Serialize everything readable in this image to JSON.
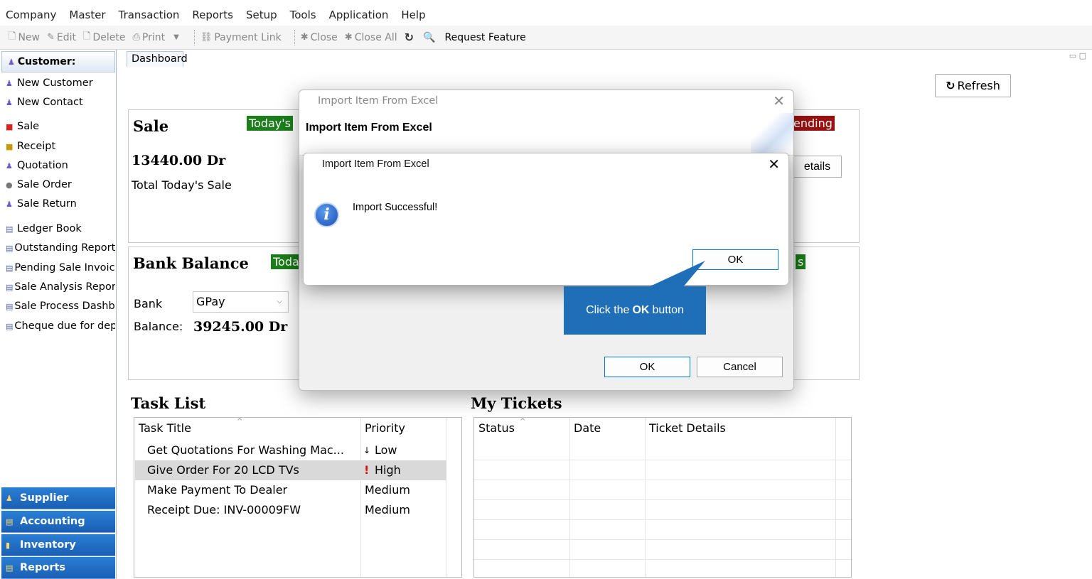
{
  "menu": [
    "Company",
    "Master",
    "Transaction",
    "Reports",
    "Setup",
    "Tools",
    "Application",
    "Help"
  ],
  "toolbar": {
    "new": "New",
    "edit": "Edit",
    "delete": "Delete",
    "print": "Print",
    "payment_link": "Payment Link",
    "close": "Close",
    "close_all": "Close All",
    "request_feature": "Request Feature"
  },
  "sidebar": {
    "header": "Customer:",
    "items": [
      "New Customer",
      "New Contact",
      "Sale",
      "Receipt",
      "Quotation",
      "Sale Order",
      "Sale Return",
      "Ledger Book",
      "Outstanding Report",
      "Pending Sale Invoices",
      "Sale Analysis Report",
      "Sale Process Dashboa",
      "Cheque due for depos"
    ],
    "groups": [
      "Supplier",
      "Accounting",
      "Inventory",
      "Reports"
    ]
  },
  "tab": {
    "label": "Dashboard"
  },
  "refresh_label": "Refresh",
  "sale_panel": {
    "title": "Sale",
    "tag": "Today's",
    "value": "13440.00 Dr",
    "caption": "Total Today's Sale",
    "right_tag": "ending",
    "right_button": "etails"
  },
  "bank_panel": {
    "title": "Bank Balance",
    "tag": "Toda",
    "bank_label": "Bank",
    "bank_value": "GPay",
    "balance_label": "Balance:",
    "balance_value": "39245.00 Dr",
    "right_tag": "s"
  },
  "task_list": {
    "title": "Task List",
    "columns": [
      "Task Title",
      "Priority"
    ],
    "rows": [
      {
        "title": "Get Quotations For Washing Mac...",
        "priority_icon": "↓",
        "priority": "Low"
      },
      {
        "title": "Give Order For 20 LCD TVs",
        "priority_icon": "!",
        "priority": "High"
      },
      {
        "title": "Make Payment To Dealer",
        "priority_icon": "",
        "priority": "Medium"
      },
      {
        "title": "Receipt Due: INV-00009FW",
        "priority_icon": "",
        "priority": "Medium"
      }
    ]
  },
  "tickets": {
    "title": "My Tickets",
    "columns": [
      "Status",
      "Date",
      "Ticket Details"
    ]
  },
  "outer_dialog": {
    "window_title": "Import Item From Excel",
    "heading": "Import Item From Excel",
    "ok": "OK",
    "cancel": "Cancel"
  },
  "inner_dialog": {
    "window_title": "Import Item From Excel",
    "message": "Import Successful!",
    "ok": "OK"
  },
  "callout": {
    "before": "Click the",
    "bold": "OK",
    "after": "button"
  },
  "colors": {
    "accent_blue": "#1e6fb8",
    "green_tag": "#1a7f1a",
    "red_tag": "#9a1010",
    "sidebar_group": "#1a5fb4"
  }
}
